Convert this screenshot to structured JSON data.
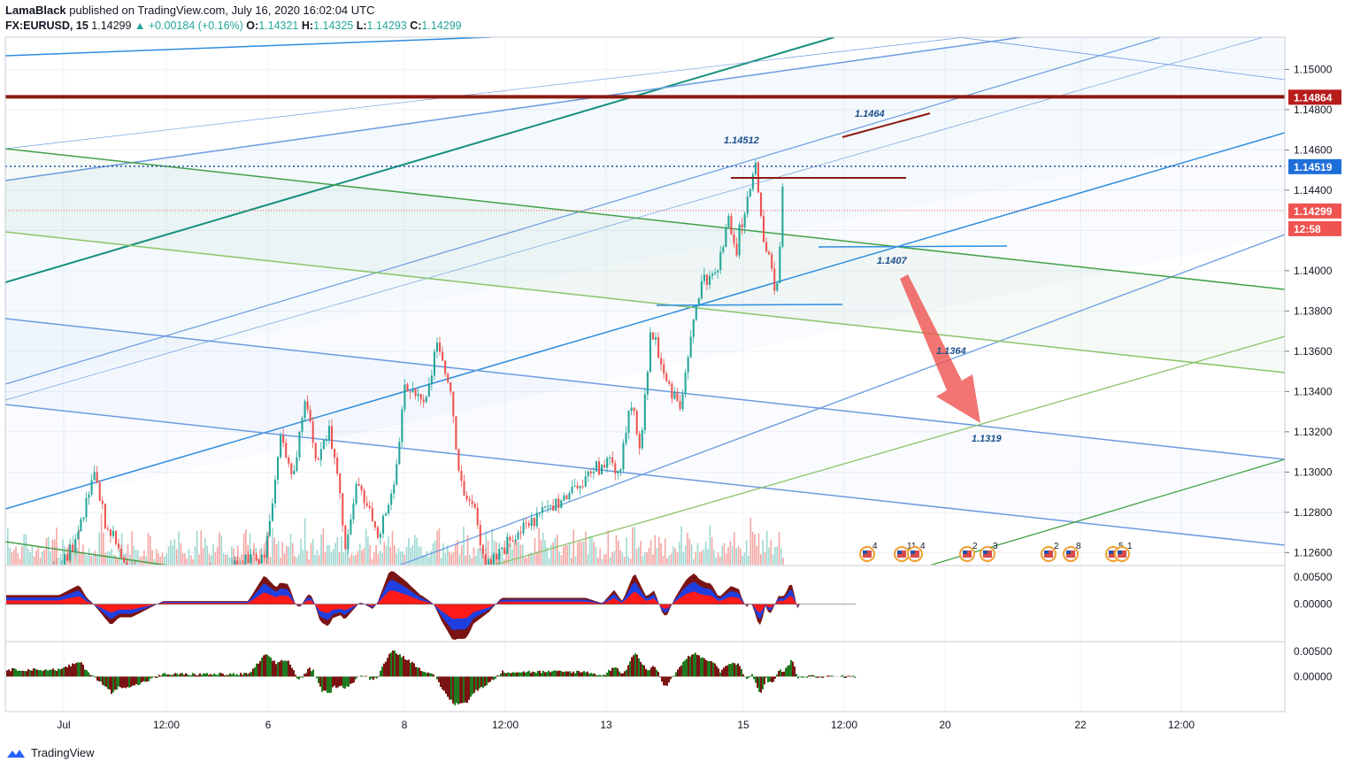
{
  "header": {
    "publisher": "LamaBlack",
    "published_text": "published on TradingView.com, July 16, 2020 16:02:04 UTC",
    "symbol": "FX:EURUSD, 15",
    "last": "1.14299",
    "change": "▲ +0.00184 (+0.16%)",
    "o_label": "O:",
    "o": "1.14321",
    "h_label": "H:",
    "h": "1.14325",
    "l_label": "L:",
    "l": "1.14293",
    "c_label": "C:",
    "c": "1.14299"
  },
  "footer": {
    "brand": "TradingView"
  },
  "colors": {
    "up": "#26a69a",
    "down": "#ef5350",
    "vol_up": "#9fd8d1",
    "vol_down": "#f5a6a3",
    "channel_blue": "#2f8ddd",
    "light_blue": "#6a9be0",
    "teal": "#16917e",
    "green": "#43a047",
    "light_green": "#8bc46a",
    "dark_red": "#8b1a10",
    "badge_red": "#b71c1c",
    "badge_blue": "#1e6fd9"
  },
  "chart_data": [
    {
      "type": "candlestick",
      "symbol": "FX:EURUSD",
      "interval": "15",
      "ylim": [
        1.1254,
        1.1516
      ],
      "y_ticks": [
        "1.15000",
        "1.14800",
        "1.14600",
        "1.14400",
        "1.14000",
        "1.13800",
        "1.13600",
        "1.13400",
        "1.13200",
        "1.13000",
        "1.12800",
        "1.12600"
      ],
      "x_ticks": [
        "Jul",
        "12:00",
        "6",
        "8",
        "12:00",
        "13",
        "15",
        "12:00",
        "20",
        "22",
        "12:00"
      ],
      "path": [
        {
          "t": "Jul 1 12:00",
          "price": 1.125
        },
        {
          "t": "Jul 2 00:00",
          "price": 1.1265
        },
        {
          "t": "Jul 2 10:00",
          "price": 1.13
        },
        {
          "t": "Jul 2 14:00",
          "price": 1.1275
        },
        {
          "t": "Jul 3 12:00",
          "price": 1.1235
        },
        {
          "t": "Jul 5 22:00",
          "price": 1.126
        },
        {
          "t": "Jul 6 06:00",
          "price": 1.132
        },
        {
          "t": "Jul 6 12:00",
          "price": 1.1295
        },
        {
          "t": "Jul 6 18:00",
          "price": 1.1335
        },
        {
          "t": "Jul 7 00:00",
          "price": 1.1305
        },
        {
          "t": "Jul 7 06:00",
          "price": 1.1325
        },
        {
          "t": "Jul 7 14:00",
          "price": 1.1265
        },
        {
          "t": "Jul 7 20:00",
          "price": 1.1295
        },
        {
          "t": "Jul 8 06:00",
          "price": 1.127
        },
        {
          "t": "Jul 8 14:00",
          "price": 1.129
        },
        {
          "t": "Jul 8 20:00",
          "price": 1.1345
        },
        {
          "t": "Jul 9 06:00",
          "price": 1.1335
        },
        {
          "t": "Jul 9 12:00",
          "price": 1.1365
        },
        {
          "t": "Jul 9 18:00",
          "price": 1.134
        },
        {
          "t": "Jul 9 22:00",
          "price": 1.13
        },
        {
          "t": "Jul 10 06:00",
          "price": 1.128
        },
        {
          "t": "Jul 10 12:00",
          "price": 1.1255
        },
        {
          "t": "Jul 12 22:00",
          "price": 1.1305
        },
        {
          "t": "Jul 13 06:00",
          "price": 1.13
        },
        {
          "t": "Jul 13 12:00",
          "price": 1.1335
        },
        {
          "t": "Jul 13 16:00",
          "price": 1.131
        },
        {
          "t": "Jul 13 22:00",
          "price": 1.137
        },
        {
          "t": "Jul 14 06:00",
          "price": 1.1345
        },
        {
          "t": "Jul 14 12:00",
          "price": 1.133
        },
        {
          "t": "Jul 14 18:00",
          "price": 1.137
        },
        {
          "t": "Jul 15 00:00",
          "price": 1.1395
        },
        {
          "t": "Jul 15 06:00",
          "price": 1.14
        },
        {
          "t": "Jul 15 12:00",
          "price": 1.1425
        },
        {
          "t": "Jul 15 16:00",
          "price": 1.141
        },
        {
          "t": "Jul 15 22:00",
          "price": 1.144
        },
        {
          "t": "Jul 16 02:00",
          "price": 1.145
        },
        {
          "t": "Jul 16 04:00",
          "price": 1.143
        },
        {
          "t": "Jul 16 06:00",
          "price": 1.141
        },
        {
          "t": "Jul 16 08:00",
          "price": 1.1415
        },
        {
          "t": "Jul 16 10:00",
          "price": 1.14
        },
        {
          "t": "Jul 16 12:00",
          "price": 1.138
        },
        {
          "t": "Jul 16 14:00",
          "price": 1.1415
        },
        {
          "t": "Jul 16 15:00",
          "price": 1.144
        },
        {
          "t": "Jul 16 16:00",
          "price": 1.143
        }
      ],
      "price_labels": [
        {
          "value": "1.14864",
          "color": "#b71c1c"
        },
        {
          "value": "1.14519",
          "color": "#1e6fd9"
        },
        {
          "value": "1.14299",
          "color": "#ef5350"
        },
        {
          "value": "12:58",
          "color": "#ef5350"
        }
      ],
      "annotations": [
        "1.14512",
        "1.1464",
        "1.1407",
        "1.1364",
        "1.1319"
      ],
      "horizontal_levels": [
        1.14864,
        1.14519,
        1.14299
      ],
      "events": [
        "4",
        "11",
        "4",
        "2",
        "3",
        "2",
        "8",
        "5",
        "1"
      ]
    },
    {
      "type": "area",
      "name": "oscillator",
      "y_ticks": [
        "0.00500",
        "0.00000"
      ],
      "ylim": [
        -0.0068,
        0.007
      ]
    },
    {
      "type": "area",
      "name": "histogram",
      "y_ticks": [
        "0.00500",
        "0.00000"
      ],
      "ylim": [
        -0.007,
        0.0068
      ]
    }
  ]
}
